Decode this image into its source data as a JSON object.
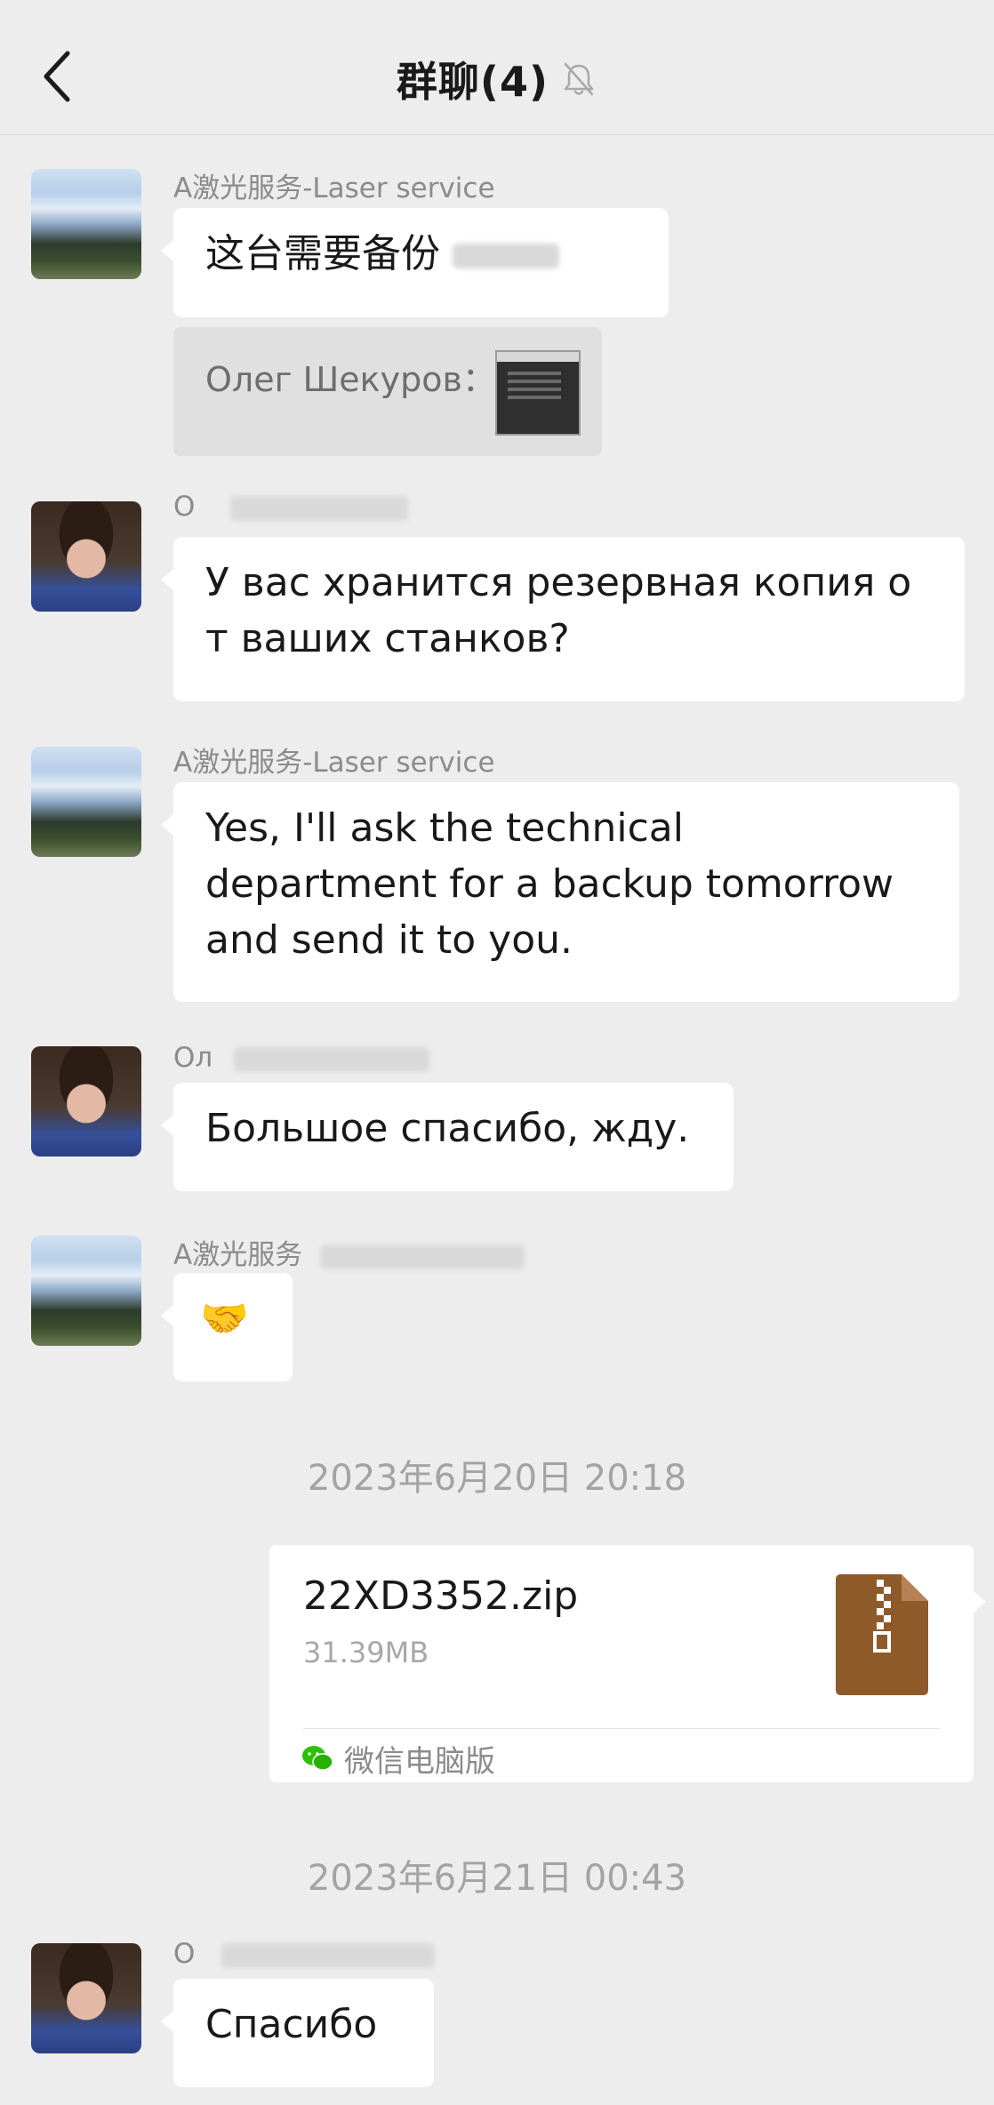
{
  "header": {
    "title": "群聊(4)",
    "back_icon": "chevron-left-icon",
    "mute_icon": "bell-off-icon"
  },
  "messages": [
    {
      "sender": "A激光服务-Laser service",
      "avatar": "laser-service-avatar",
      "text": "这台需要备份",
      "quote": {
        "author": "Олег Шекуров：",
        "thumb": "machine-photo"
      }
    },
    {
      "sender": "O",
      "avatar": "oleg-avatar",
      "lines": [
        "У вас хранится резервная копия о",
        "т ваших станков?"
      ]
    },
    {
      "sender": "A激光服务-Laser service",
      "avatar": "laser-service-avatar",
      "lines": [
        "Yes, I'll ask the technical",
        "department for a backup tomorrow",
        "and send it to you."
      ]
    },
    {
      "sender": "Ол",
      "avatar": "oleg-avatar",
      "text": "Большое спасибо, жду."
    },
    {
      "sender": "A激光服务",
      "avatar": "laser-service-avatar",
      "text": "🤝"
    },
    {
      "sender": "O",
      "avatar": "oleg-avatar",
      "text": "Спасибо"
    }
  ],
  "timestamps": [
    "2023年6月20日 20:18",
    "2023年6月21日 00:43"
  ],
  "file": {
    "name": "22XD3352.zip",
    "size": "31.39MB",
    "source": "微信电脑版",
    "icon": "zip-file-icon",
    "source_icon": "wechat-icon",
    "icon_color": "#8f5a2a"
  },
  "colors": {
    "background": "#ededed",
    "bubble": "#ffffff",
    "quote_bg": "#e0e0e0",
    "meta_text": "#a3a3a3"
  }
}
